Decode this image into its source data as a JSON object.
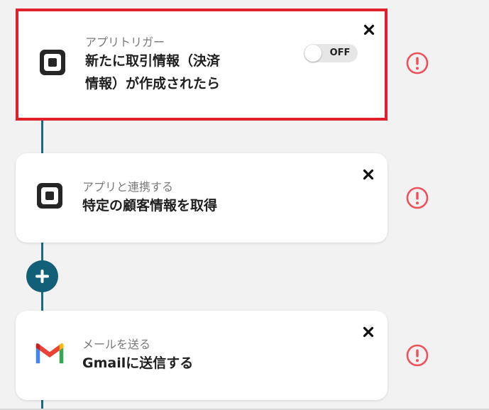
{
  "colors": {
    "background": "#f2f2f2",
    "connector": "#1a6a80",
    "selected_border": "#e0202a",
    "warning": "#f0505a",
    "add_button": "#125f78"
  },
  "steps": [
    {
      "app_icon": "square-logo-icon",
      "subtitle": "アプリトリガー",
      "title_line1": "新たに取引情報（決済",
      "title_line2": "情報）が作成されたら",
      "toggle_label": "OFF",
      "toggle_on": false,
      "selected": true
    },
    {
      "app_icon": "square-logo-icon",
      "subtitle": "アプリと連携する",
      "title_line1": "特定の顧客情報を取得"
    },
    {
      "app_icon": "gmail-icon",
      "subtitle": "メールを送る",
      "title_line1": "Gmailに送信する"
    }
  ]
}
